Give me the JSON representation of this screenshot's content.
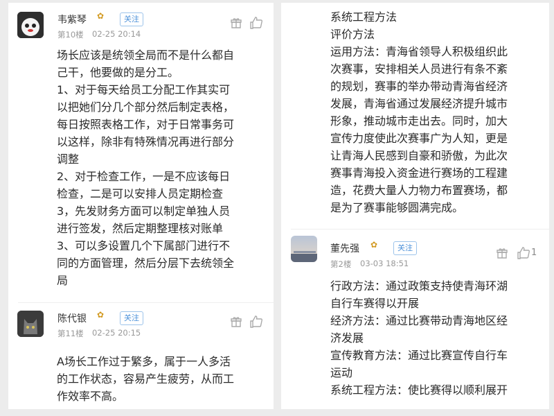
{
  "left": {
    "posts": [
      {
        "user": "韦紫琴",
        "floor": "第10楼",
        "time": "02-25 20:14",
        "follow": "关注",
        "like_count": "",
        "body": [
          "场长应该是统领全局而不是什么都自",
          "己干，他要做的是分工。",
          "1、对于每天给员工分配工作其实可",
          "以把她们分几个部分然后制定表格，",
          "每日按照表格工作，对于日常事务可",
          "以这样，除非有特殊情况再进行部分",
          "调整",
          "2、对于检查工作，一是不应该每日",
          "检查，二是可以安排人员定期检查",
          "3，先发财务方面可以制定单独人员",
          "进行签发，然后定期整理核对账单",
          "3、可以多设置几个下属部门进行不",
          "同的方面管理，然后分层下去统领全",
          "局"
        ]
      },
      {
        "user": "陈代银",
        "floor": "第11楼",
        "time": "02-25 20:15",
        "follow": "关注",
        "like_count": "",
        "body": [
          "A场长工作过于繁多，属于一人多活",
          "的工作状态，容易产生疲劳，从而工",
          "作效率不高。"
        ]
      }
    ]
  },
  "right": {
    "top_body": [
      "系统工程方法",
      "评价方法",
      "运用方法：青海省领导人积极组织此",
      "次赛事，安排相关人员进行有条不紊",
      "的规划，赛事的举办带动青海省经济",
      "发展，青海省通过发展经济提升城市",
      "形象，推动城市走出去。同时，加大",
      "宣传力度使此次赛事广为人知，更是",
      "让青海人民感到自豪和骄傲，为此次",
      "赛事青海投入资金进行赛场的工程建",
      "造，花费大量人力物力布置赛场，都",
      "是为了赛事能够圆满完成。"
    ],
    "post": {
      "user": "董先强",
      "floor": "第2楼",
      "time": "03-03 18:51",
      "follow": "关注",
      "like_count": "1",
      "body": [
        "行政方法：通过政策支持使青海环湖",
        "自行车赛得以开展",
        "经济方法：通过比赛带动青海地区经",
        "济发展",
        "宣传教育方法：通过比赛宣传自行车",
        "运动",
        "系统工程方法：使比赛得以顺利展开"
      ]
    }
  },
  "icons": {
    "flower": "flower-badge-icon",
    "gift": "gift-icon",
    "like": "thumbs-up-icon"
  }
}
